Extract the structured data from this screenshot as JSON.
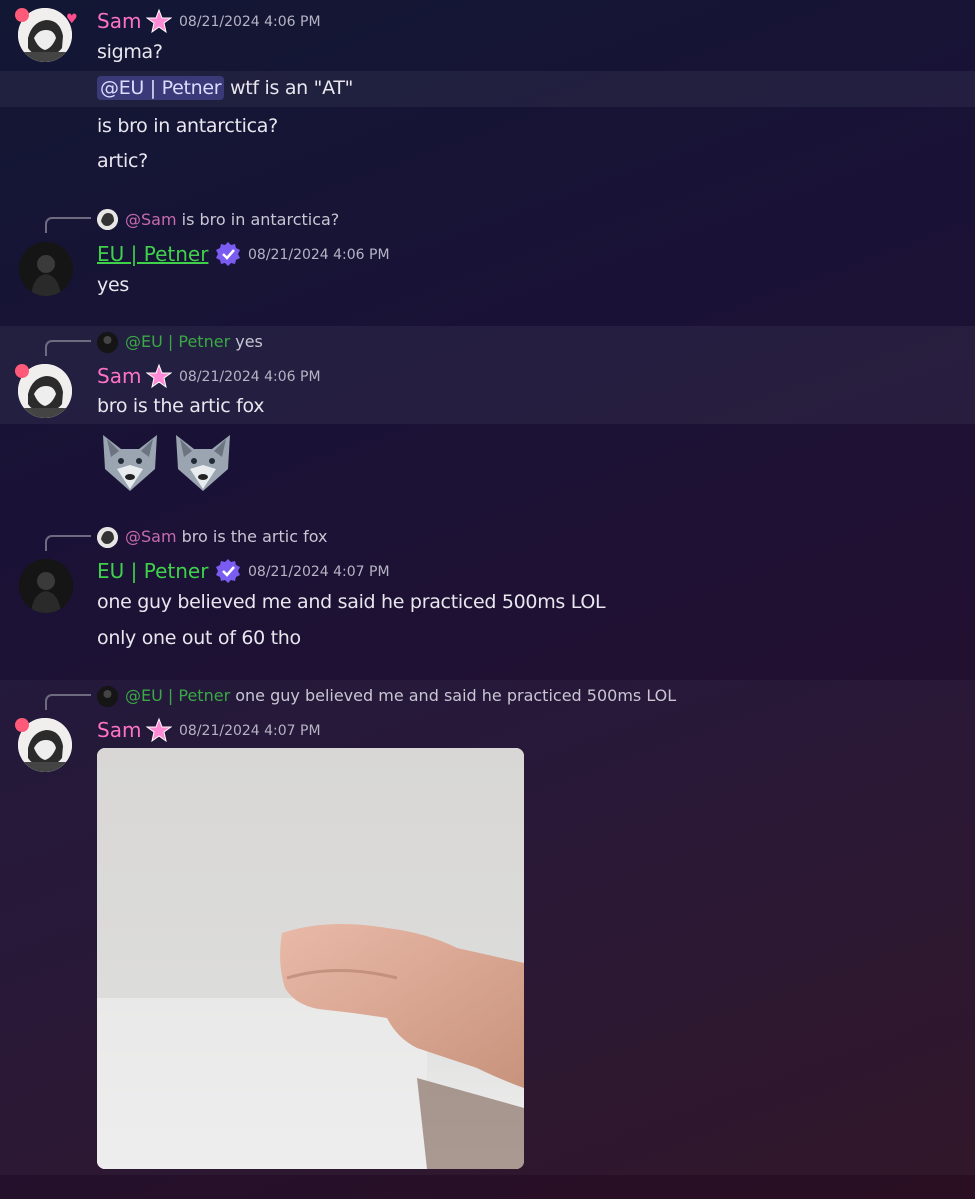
{
  "users": {
    "sam": "Sam",
    "eu": "EU | Petner"
  },
  "messages": {
    "m1": {
      "timestamp": "08/21/2024 4:06 PM",
      "lines": [
        "sigma?"
      ],
      "mention": "@EU | Petner",
      "mention_text": " wtf is an \"AT\"",
      "lines2": [
        "is bro in antarctica?",
        "artic?"
      ]
    },
    "m2": {
      "reply_user": "@Sam",
      "reply_text": "is bro in antarctica?",
      "timestamp": "08/21/2024 4:06 PM",
      "lines": [
        "yes"
      ]
    },
    "m3": {
      "reply_user": "@EU | Petner",
      "reply_text": "yes",
      "timestamp": "08/21/2024 4:06 PM",
      "lines": [
        "bro is the artic fox"
      ],
      "emojis": [
        "wolf-emoji",
        "wolf-emoji"
      ]
    },
    "m4": {
      "reply_user": "@Sam",
      "reply_text": "bro is the artic fox",
      "timestamp": "08/21/2024 4:07 PM",
      "lines": [
        "one guy believed me and said he practiced 500ms LOL",
        "only one out of 60 tho"
      ]
    },
    "m5": {
      "reply_user": "@EU | Petner",
      "reply_text": "one guy believed me and said he practiced 500ms LOL",
      "timestamp": "08/21/2024 4:07 PM",
      "attachment": "video-thumbnail"
    }
  },
  "colors": {
    "sam_name": "#ff73c7",
    "eu_name": "#3fd14a",
    "badge_purple": "#7a5cf0"
  }
}
